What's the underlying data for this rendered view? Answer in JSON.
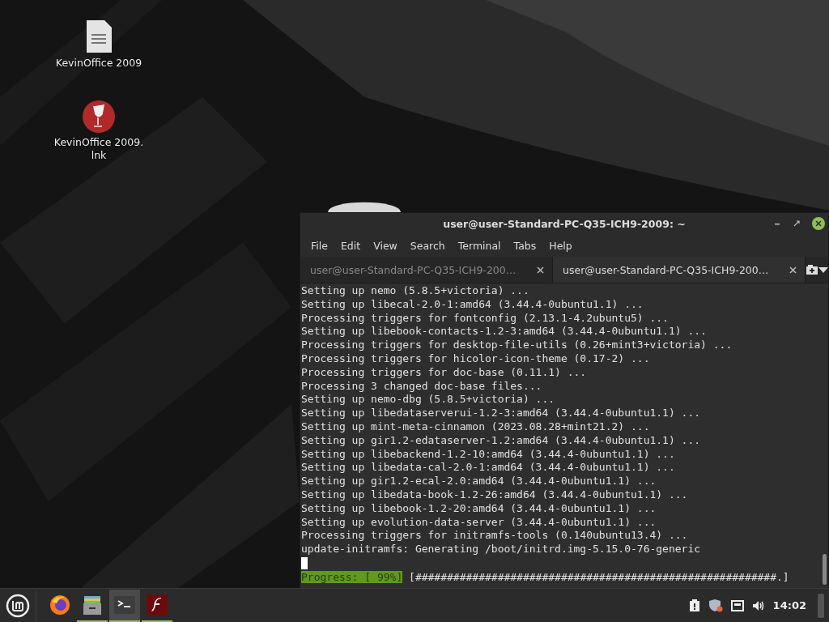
{
  "desktop_icons": [
    {
      "kind": "document",
      "label": "KevinOffice 2009"
    },
    {
      "kind": "wine",
      "label": "KevinOffice 2009.\nlnk"
    }
  ],
  "terminal": {
    "title": "user@user-Standard-PC-Q35-ICH9-2009: ~",
    "menu": [
      "File",
      "Edit",
      "View",
      "Search",
      "Terminal",
      "Tabs",
      "Help"
    ],
    "tabs": [
      {
        "label": "user@user-Standard-PC-Q35-ICH9-200…",
        "selected": false
      },
      {
        "label": "user@user-Standard-PC-Q35-ICH9-200…",
        "selected": true
      }
    ],
    "lines": [
      "Setting up nemo (5.8.5+victoria) ...",
      "Setting up libecal-2.0-1:amd64 (3.44.4-0ubuntu1.1) ...",
      "Processing triggers for fontconfig (2.13.1-4.2ubuntu5) ...",
      "Setting up libebook-contacts-1.2-3:amd64 (3.44.4-0ubuntu1.1) ...",
      "Processing triggers for desktop-file-utils (0.26+mint3+victoria) ...",
      "Processing triggers for hicolor-icon-theme (0.17-2) ...",
      "Processing triggers for doc-base (0.11.1) ...",
      "Processing 3 changed doc-base files...",
      "Setting up nemo-dbg (5.8.5+victoria) ...",
      "Setting up libedataserverui-1.2-3:amd64 (3.44.4-0ubuntu1.1) ...",
      "Setting up mint-meta-cinnamon (2023.08.28+mint21.2) ...",
      "Setting up gir1.2-edataserver-1.2:amd64 (3.44.4-0ubuntu1.1) ...",
      "Setting up libebackend-1.2-10:amd64 (3.44.4-0ubuntu1.1) ...",
      "Setting up libedata-cal-2.0-1:amd64 (3.44.4-0ubuntu1.1) ...",
      "Setting up gir1.2-ecal-2.0:amd64 (3.44.4-0ubuntu1.1) ...",
      "Setting up libedata-book-1.2-26:amd64 (3.44.4-0ubuntu1.1) ...",
      "Setting up libebook-1.2-20:amd64 (3.44.4-0ubuntu1.1) ...",
      "Setting up evolution-data-server (3.44.4-0ubuntu1.1) ...",
      "Processing triggers for initramfs-tools (0.140ubuntu13.4) ...",
      "update-initramfs: Generating /boot/initrd.img-5.15.0-76-generic"
    ],
    "progress": {
      "label": "Progress: [ 99%]",
      "bar": "[#########################################################.]"
    }
  },
  "taskbar": {
    "launchers": [
      {
        "kind": "firefox",
        "running": false,
        "active": false
      },
      {
        "kind": "files",
        "running": true,
        "active": false
      },
      {
        "kind": "terminal",
        "running": true,
        "active": true
      },
      {
        "kind": "flash",
        "running": true,
        "active": false
      }
    ],
    "clock": "14:02"
  }
}
